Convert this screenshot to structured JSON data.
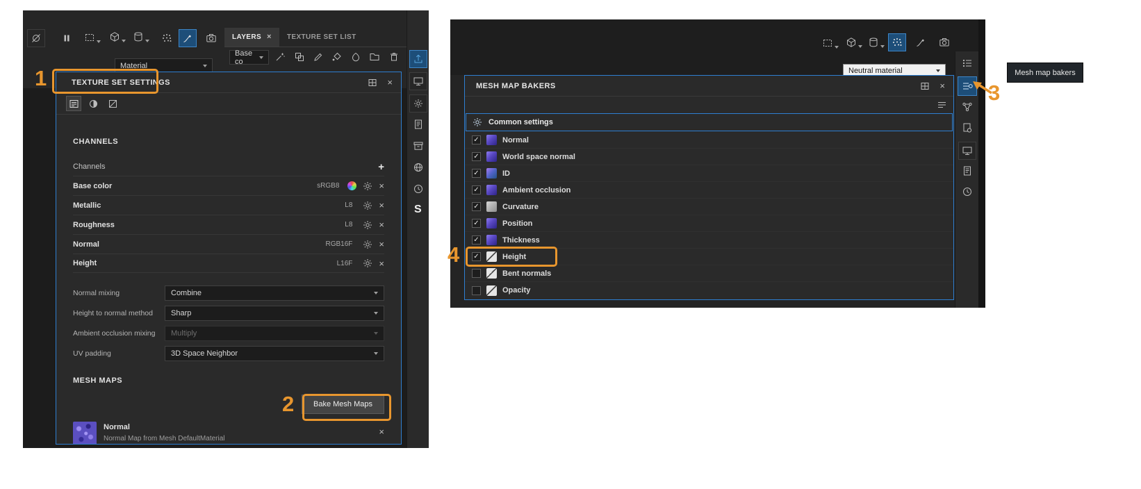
{
  "annotations": {
    "step1": "1",
    "step2": "2",
    "step3": "3",
    "step4": "4",
    "tooltip": "Mesh map bakers",
    "highlight_color": "#E8962E"
  },
  "left_window": {
    "tabs": {
      "layers": "LAYERS",
      "texture_set_list": "TEXTURE SET LIST"
    },
    "material_dropdown": "Material",
    "blend_dropdown": "Base co",
    "strip_logo": "S",
    "texture_set_settings": {
      "title": "TEXTURE SET SETTINGS",
      "channels_heading": "CHANNELS",
      "channels_label": "Channels",
      "channels": [
        {
          "name": "Base color",
          "format": "sRGB8"
        },
        {
          "name": "Metallic",
          "format": "L8"
        },
        {
          "name": "Roughness",
          "format": "L8"
        },
        {
          "name": "Normal",
          "format": "RGB16F"
        },
        {
          "name": "Height",
          "format": "L16F"
        }
      ],
      "params": [
        {
          "label": "Normal mixing",
          "value": "Combine"
        },
        {
          "label": "Height to normal method",
          "value": "Sharp"
        },
        {
          "label": "Ambient occlusion mixing",
          "value": "Multiply"
        },
        {
          "label": "UV padding",
          "value": "3D Space Neighbor"
        }
      ],
      "mesh_maps_heading": "MESH MAPS",
      "bake_button": "Bake Mesh Maps",
      "mesh_map_entry": {
        "name": "Normal",
        "description": "Normal Map from Mesh DefaultMaterial"
      }
    }
  },
  "right_window": {
    "material_dropdown": "Neutral material",
    "mesh_map_bakers": {
      "title": "MESH MAP BAKERS",
      "common_settings": "Common settings",
      "bakers": [
        {
          "label": "Normal",
          "mark": "✓"
        },
        {
          "label": "World space normal",
          "mark": "✓"
        },
        {
          "label": "ID",
          "mark": "✓"
        },
        {
          "label": "Ambient occlusion",
          "mark": "✓"
        },
        {
          "label": "Curvature",
          "mark": "✓"
        },
        {
          "label": "Position",
          "mark": "✓"
        },
        {
          "label": "Thickness",
          "mark": "✓"
        },
        {
          "label": "Height",
          "mark": "✓"
        },
        {
          "label": "Bent normals",
          "mark": ""
        },
        {
          "label": "Opacity",
          "mark": ""
        }
      ]
    }
  }
}
